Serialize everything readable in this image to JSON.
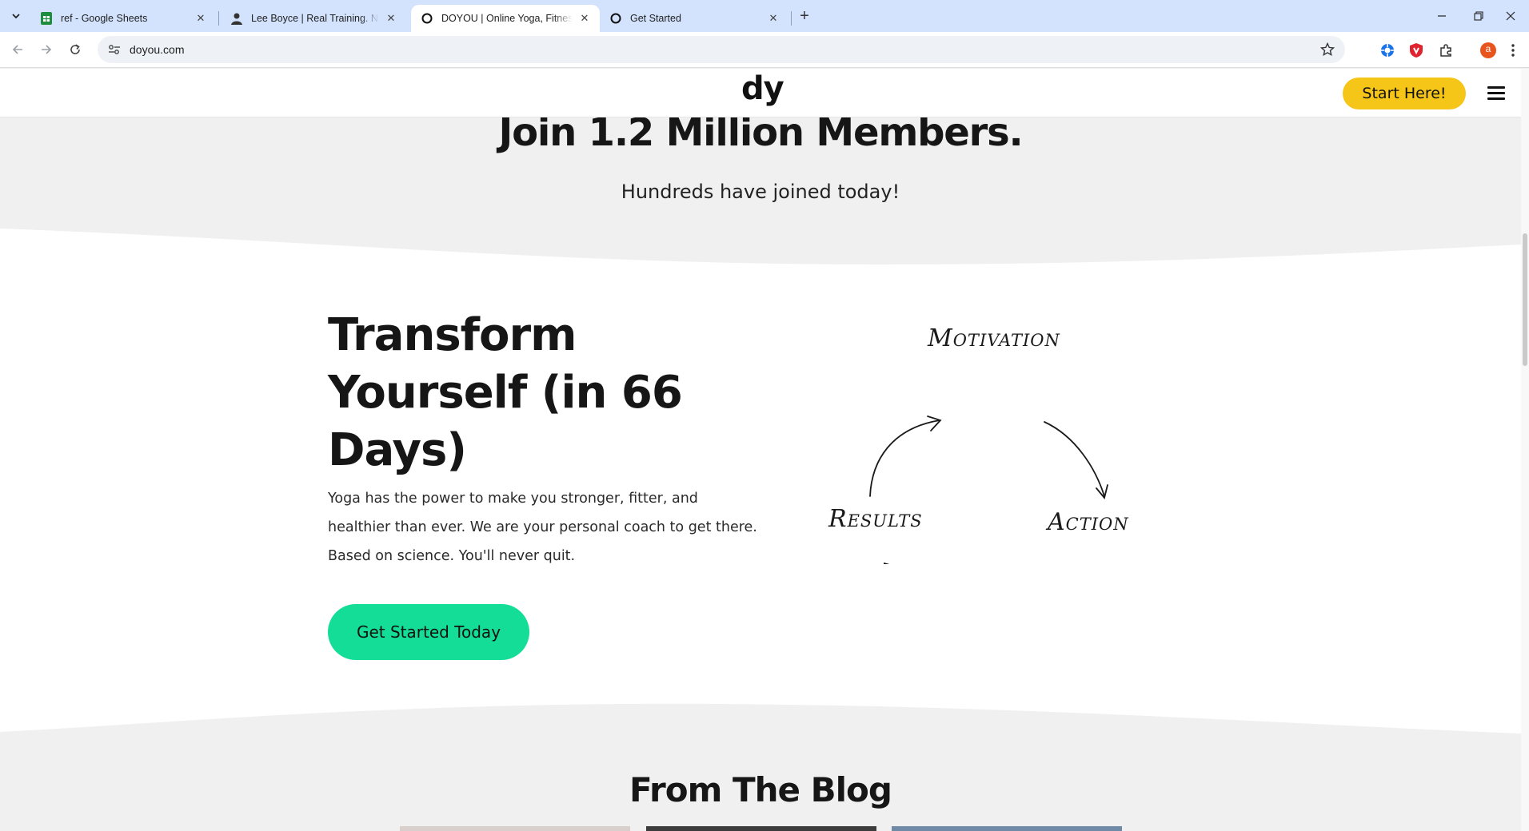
{
  "browser": {
    "tabs": [
      {
        "title": "ref - Google Sheets",
        "favicon": "google-sheets-icon",
        "active": false
      },
      {
        "title": "Lee Boyce | Real Training. No Nonsense.",
        "favicon": "person-avatar-icon",
        "active": false
      },
      {
        "title": "DOYOU | Online Yoga, Fitness, & Wellness",
        "favicon": "doyou-circle-icon",
        "active": true
      },
      {
        "title": "Get Started",
        "favicon": "doyou-circle-icon",
        "active": false
      }
    ],
    "url": "doyou.com",
    "profile_initial": "a",
    "colors": {
      "tabstrip": "#d3e3fd",
      "profile": "#e8541e",
      "shield_ext": "#e0242f",
      "blue_ext": "#1a73e8"
    }
  },
  "site": {
    "logo": "dy",
    "header_cta": "Start Here!",
    "colors": {
      "header_cta": "#f5c518",
      "main_cta": "#13dd97",
      "text": "#161616",
      "band_gray": "#f0f0f0"
    }
  },
  "hero": {
    "join_heading": "Join 1.2 Million Members.",
    "joined_today": "Hundreds have joined today!"
  },
  "transform": {
    "heading_line1": "Transform",
    "heading_line2": "Yourself (in 66",
    "heading_line3": "Days)",
    "description": "Yoga has the power to make you stronger, fitter, and healthier than ever. We are your personal coach to get there. Based on science. You'll never quit.",
    "cta": "Get Started Today"
  },
  "cycle_diagram": {
    "nodes": [
      "Motivation",
      "Action",
      "Results"
    ]
  },
  "blog": {
    "heading": "From The Blog",
    "thumb_colors": [
      "#d9d0cd",
      "#3c3c3c",
      "#6f8aa6"
    ]
  }
}
